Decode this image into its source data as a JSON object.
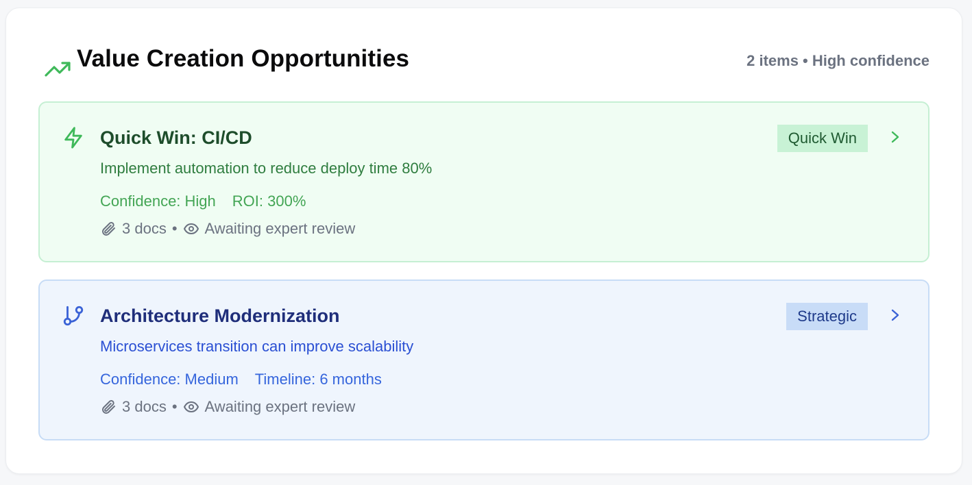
{
  "header": {
    "icon": "trending-up-icon",
    "title": "Value Creation Opportunities",
    "meta": "2 items • High confidence"
  },
  "colors": {
    "accent_green": "#3fb95a",
    "accent_blue": "#3a62d6"
  },
  "cards": [
    {
      "icon": "zap-icon",
      "title": "Quick Win: CI/CD",
      "description": "Implement automation to reduce deploy time 80%",
      "stats": [
        "Confidence: High",
        "ROI: 300%"
      ],
      "docs": "3 docs",
      "separator": "•",
      "status": "Awaiting expert review",
      "badge": "Quick Win"
    },
    {
      "icon": "git-branch-icon",
      "title": "Architecture Modernization",
      "description": "Microservices transition can improve scalability",
      "stats": [
        "Confidence: Medium",
        "Timeline: 6 months"
      ],
      "docs": "3 docs",
      "separator": "•",
      "status": "Awaiting expert review",
      "badge": "Strategic"
    }
  ]
}
